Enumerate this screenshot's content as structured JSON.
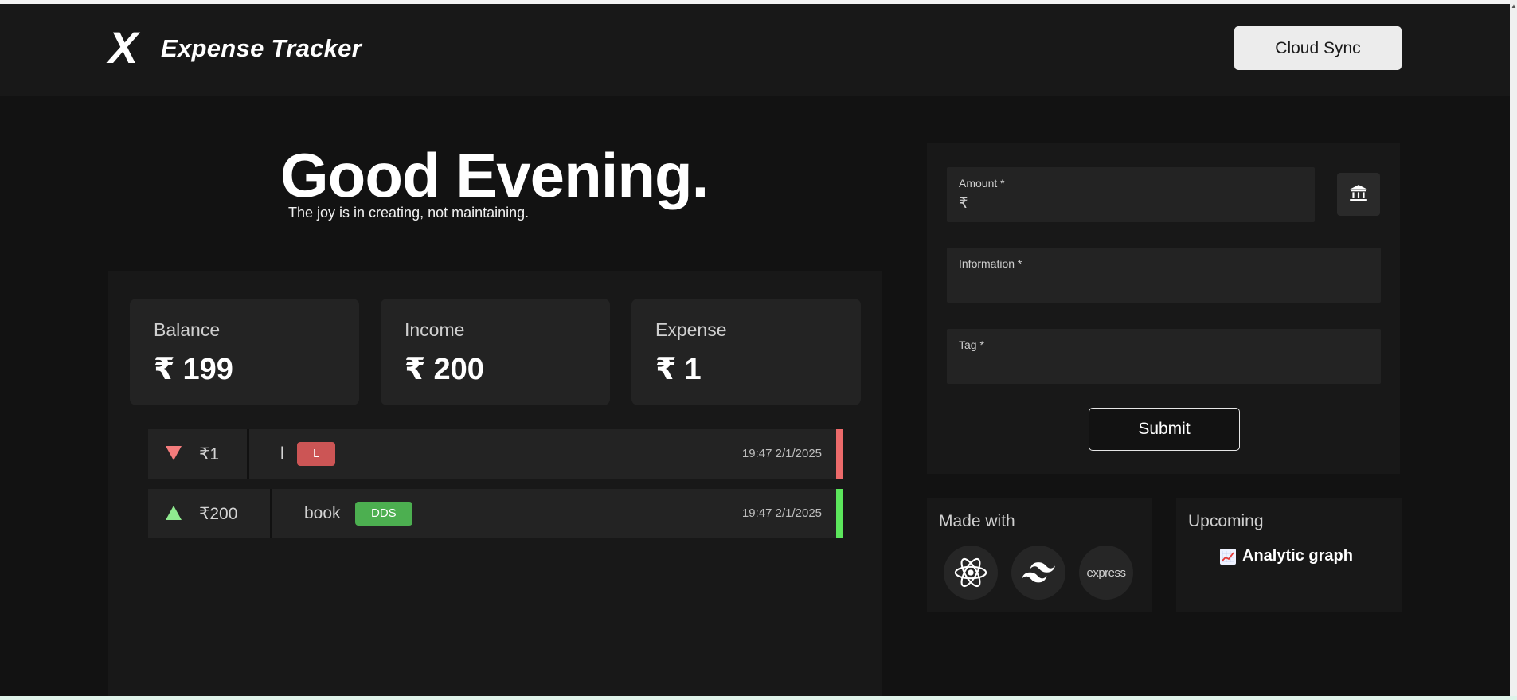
{
  "header": {
    "logo_letter": "X",
    "brand": "Expense Tracker",
    "cloud_sync_label": "Cloud Sync"
  },
  "greeting": {
    "title": "Good Evening.",
    "tagline": "The joy is in creating, not maintaining."
  },
  "stats": [
    {
      "label": "Balance",
      "currency": "₹",
      "value": "199"
    },
    {
      "label": "Income",
      "currency": "₹",
      "value": "200"
    },
    {
      "label": "Expense",
      "currency": "₹",
      "value": "1"
    }
  ],
  "transactions": [
    {
      "type": "expense",
      "amount": "₹1",
      "info": "l",
      "tag": "L",
      "time": "19:47 2/1/2025",
      "color": "#e06666",
      "tag_color": "#cc5555"
    },
    {
      "type": "income",
      "amount": "₹200",
      "info": "book",
      "tag": "DDS",
      "time": "19:47 2/1/2025",
      "color": "#5ce65c",
      "tag_color": "#4caf50"
    }
  ],
  "form": {
    "amount_label": "Amount *",
    "currency_prefix": "₹",
    "amount_value": "",
    "information_label": "Information *",
    "information_value": "",
    "tag_label": "Tag *",
    "tag_value": "",
    "bank_icon": "bank-icon",
    "submit_label": "Submit"
  },
  "made_with": {
    "title": "Made with",
    "tech": [
      {
        "name": "react",
        "icon": "react-icon"
      },
      {
        "name": "tailwind",
        "icon": "tailwind-icon"
      },
      {
        "name": "express",
        "label": "express"
      }
    ]
  },
  "upcoming": {
    "title": "Upcoming",
    "item": "Analytic graph",
    "icon": "chart-increasing-icon"
  },
  "colors": {
    "background": "#121212",
    "panel": "#181818",
    "card": "#232323",
    "expense": "#e06666",
    "income": "#5ce65c"
  }
}
